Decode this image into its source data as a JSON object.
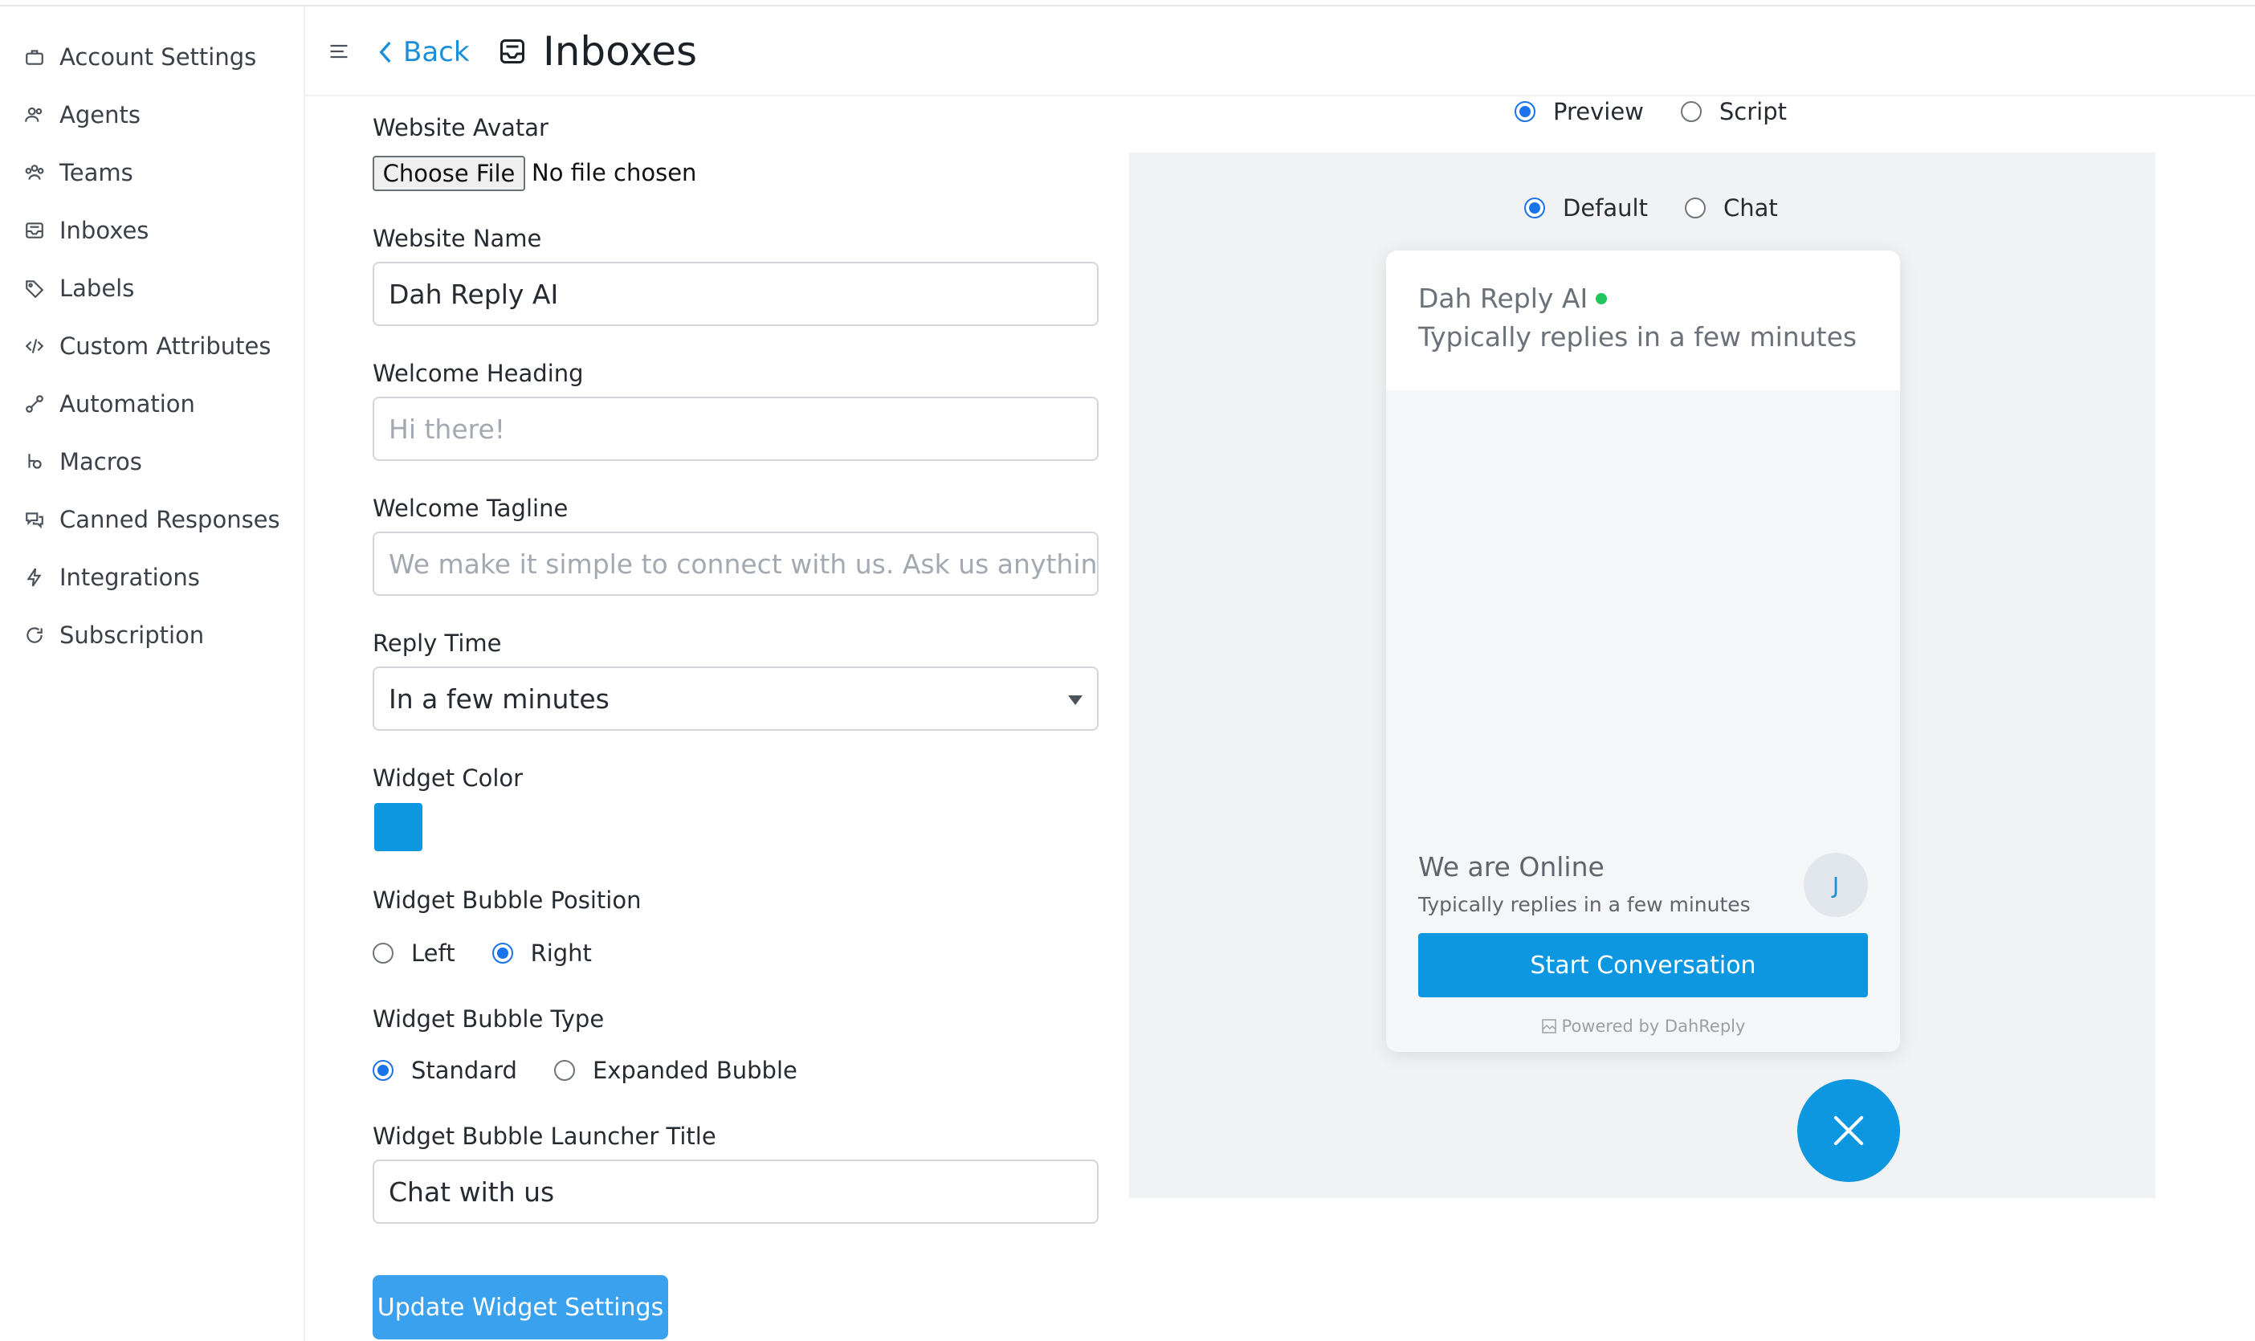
{
  "sidebar": {
    "items": [
      {
        "label": "Account Settings",
        "icon": "briefcase-icon"
      },
      {
        "label": "Agents",
        "icon": "users-icon"
      },
      {
        "label": "Teams",
        "icon": "team-icon"
      },
      {
        "label": "Inboxes",
        "icon": "inbox-icon"
      },
      {
        "label": "Labels",
        "icon": "tag-icon"
      },
      {
        "label": "Custom Attributes",
        "icon": "code-icon"
      },
      {
        "label": "Automation",
        "icon": "automation-icon"
      },
      {
        "label": "Macros",
        "icon": "macro-icon"
      },
      {
        "label": "Canned Responses",
        "icon": "chat-bubbles-icon"
      },
      {
        "label": "Integrations",
        "icon": "bolt-icon"
      },
      {
        "label": "Subscription",
        "icon": "refresh-icon"
      }
    ]
  },
  "header": {
    "back_label": "Back",
    "title": "Inboxes"
  },
  "form": {
    "avatar_label": "Website Avatar",
    "choose_file": "Choose File",
    "no_file": "No file chosen",
    "website_name_label": "Website Name",
    "website_name_value": "Dah Reply AI",
    "welcome_heading_label": "Welcome Heading",
    "welcome_heading_placeholder": "Hi there!",
    "welcome_tagline_label": "Welcome Tagline",
    "welcome_tagline_placeholder": "We make it simple to connect with us. Ask us anything, or s",
    "reply_time_label": "Reply Time",
    "reply_time_value": "In a few minutes",
    "widget_color_label": "Widget Color",
    "widget_color": "#0d97e0",
    "bubble_position_label": "Widget Bubble Position",
    "position_left": "Left",
    "position_right": "Right",
    "position_selected": "Right",
    "bubble_type_label": "Widget Bubble Type",
    "type_standard": "Standard",
    "type_expanded": "Expanded Bubble",
    "type_selected": "Standard",
    "launcher_title_label": "Widget Bubble Launcher Title",
    "launcher_title_value": "Chat with us",
    "update_button": "Update Widget Settings"
  },
  "preview": {
    "mode_preview": "Preview",
    "mode_script": "Script",
    "mode_selected": "Preview",
    "view_default": "Default",
    "view_chat": "Chat",
    "view_selected": "Default",
    "widget": {
      "name": "Dah Reply AI",
      "reply_text": "Typically replies in a few minutes",
      "online_title": "We are Online",
      "online_sub": "Typically replies in a few minutes",
      "avatar_initial": "J",
      "start_button": "Start Conversation",
      "powered_by": "Powered by DahReply"
    }
  }
}
